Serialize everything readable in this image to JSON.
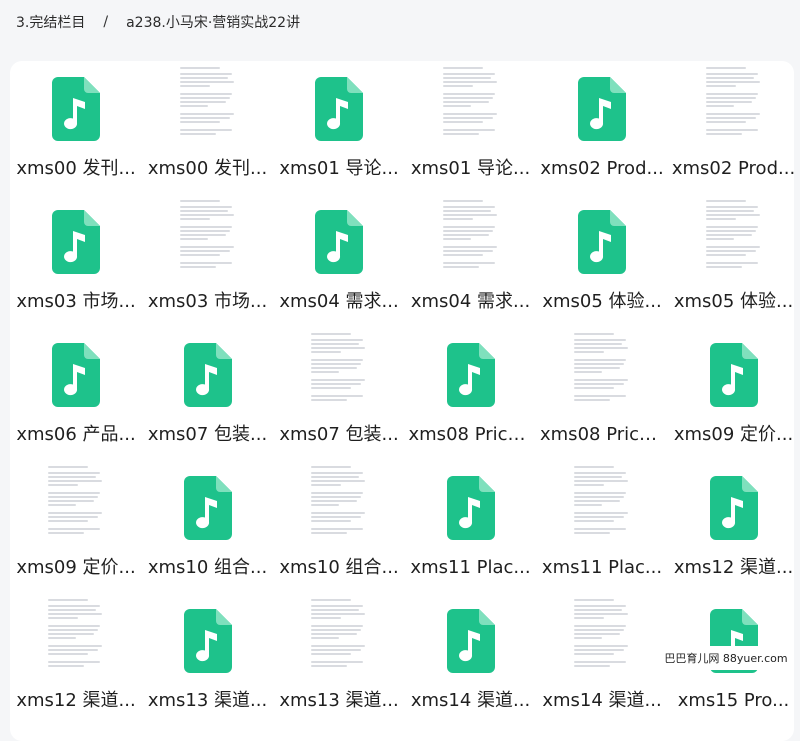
{
  "breadcrumb": {
    "parent": "3.完结栏目",
    "separator": "/",
    "current": "a238.小马宋·营销实战22讲"
  },
  "colors": {
    "audio_icon": "#1ec28b",
    "background": "#f5f6f8"
  },
  "files": [
    {
      "name": "xms00 发刊...",
      "type": "audio"
    },
    {
      "name": "xms00 发刊...",
      "type": "doc"
    },
    {
      "name": "xms01 导论...",
      "type": "audio"
    },
    {
      "name": "xms01 导论...",
      "type": "doc"
    },
    {
      "name": "xms02 Prod...",
      "type": "audio"
    },
    {
      "name": "xms02 Prod...",
      "type": "doc"
    },
    {
      "name": "xms03 市场...",
      "type": "audio"
    },
    {
      "name": "xms03 市场...",
      "type": "doc"
    },
    {
      "name": "xms04 需求...",
      "type": "audio"
    },
    {
      "name": "xms04 需求...",
      "type": "doc"
    },
    {
      "name": "xms05 体验...",
      "type": "audio"
    },
    {
      "name": "xms05 体验...",
      "type": "doc"
    },
    {
      "name": "xms06 产品...",
      "type": "audio"
    },
    {
      "name": "xms07 包装...",
      "type": "audio"
    },
    {
      "name": "xms07 包装...",
      "type": "doc"
    },
    {
      "name": "xms08 Price...",
      "type": "audio"
    },
    {
      "name": "xms08 Price...",
      "type": "doc"
    },
    {
      "name": "xms09 定价...",
      "type": "audio"
    },
    {
      "name": "xms09 定价...",
      "type": "doc"
    },
    {
      "name": "xms10 组合...",
      "type": "audio"
    },
    {
      "name": "xms10 组合...",
      "type": "doc"
    },
    {
      "name": "xms11 Plac...",
      "type": "audio"
    },
    {
      "name": "xms11 Plac...",
      "type": "doc"
    },
    {
      "name": "xms12 渠道...",
      "type": "audio"
    },
    {
      "name": "xms12 渠道...",
      "type": "doc"
    },
    {
      "name": "xms13 渠道...",
      "type": "audio"
    },
    {
      "name": "xms13 渠道...",
      "type": "doc"
    },
    {
      "name": "xms14 渠道...",
      "type": "audio"
    },
    {
      "name": "xms14 渠道...",
      "type": "doc"
    },
    {
      "name": "xms15 Pro...",
      "type": "audio"
    }
  ],
  "watermark": "巴巴育儿网 88yuer.com"
}
